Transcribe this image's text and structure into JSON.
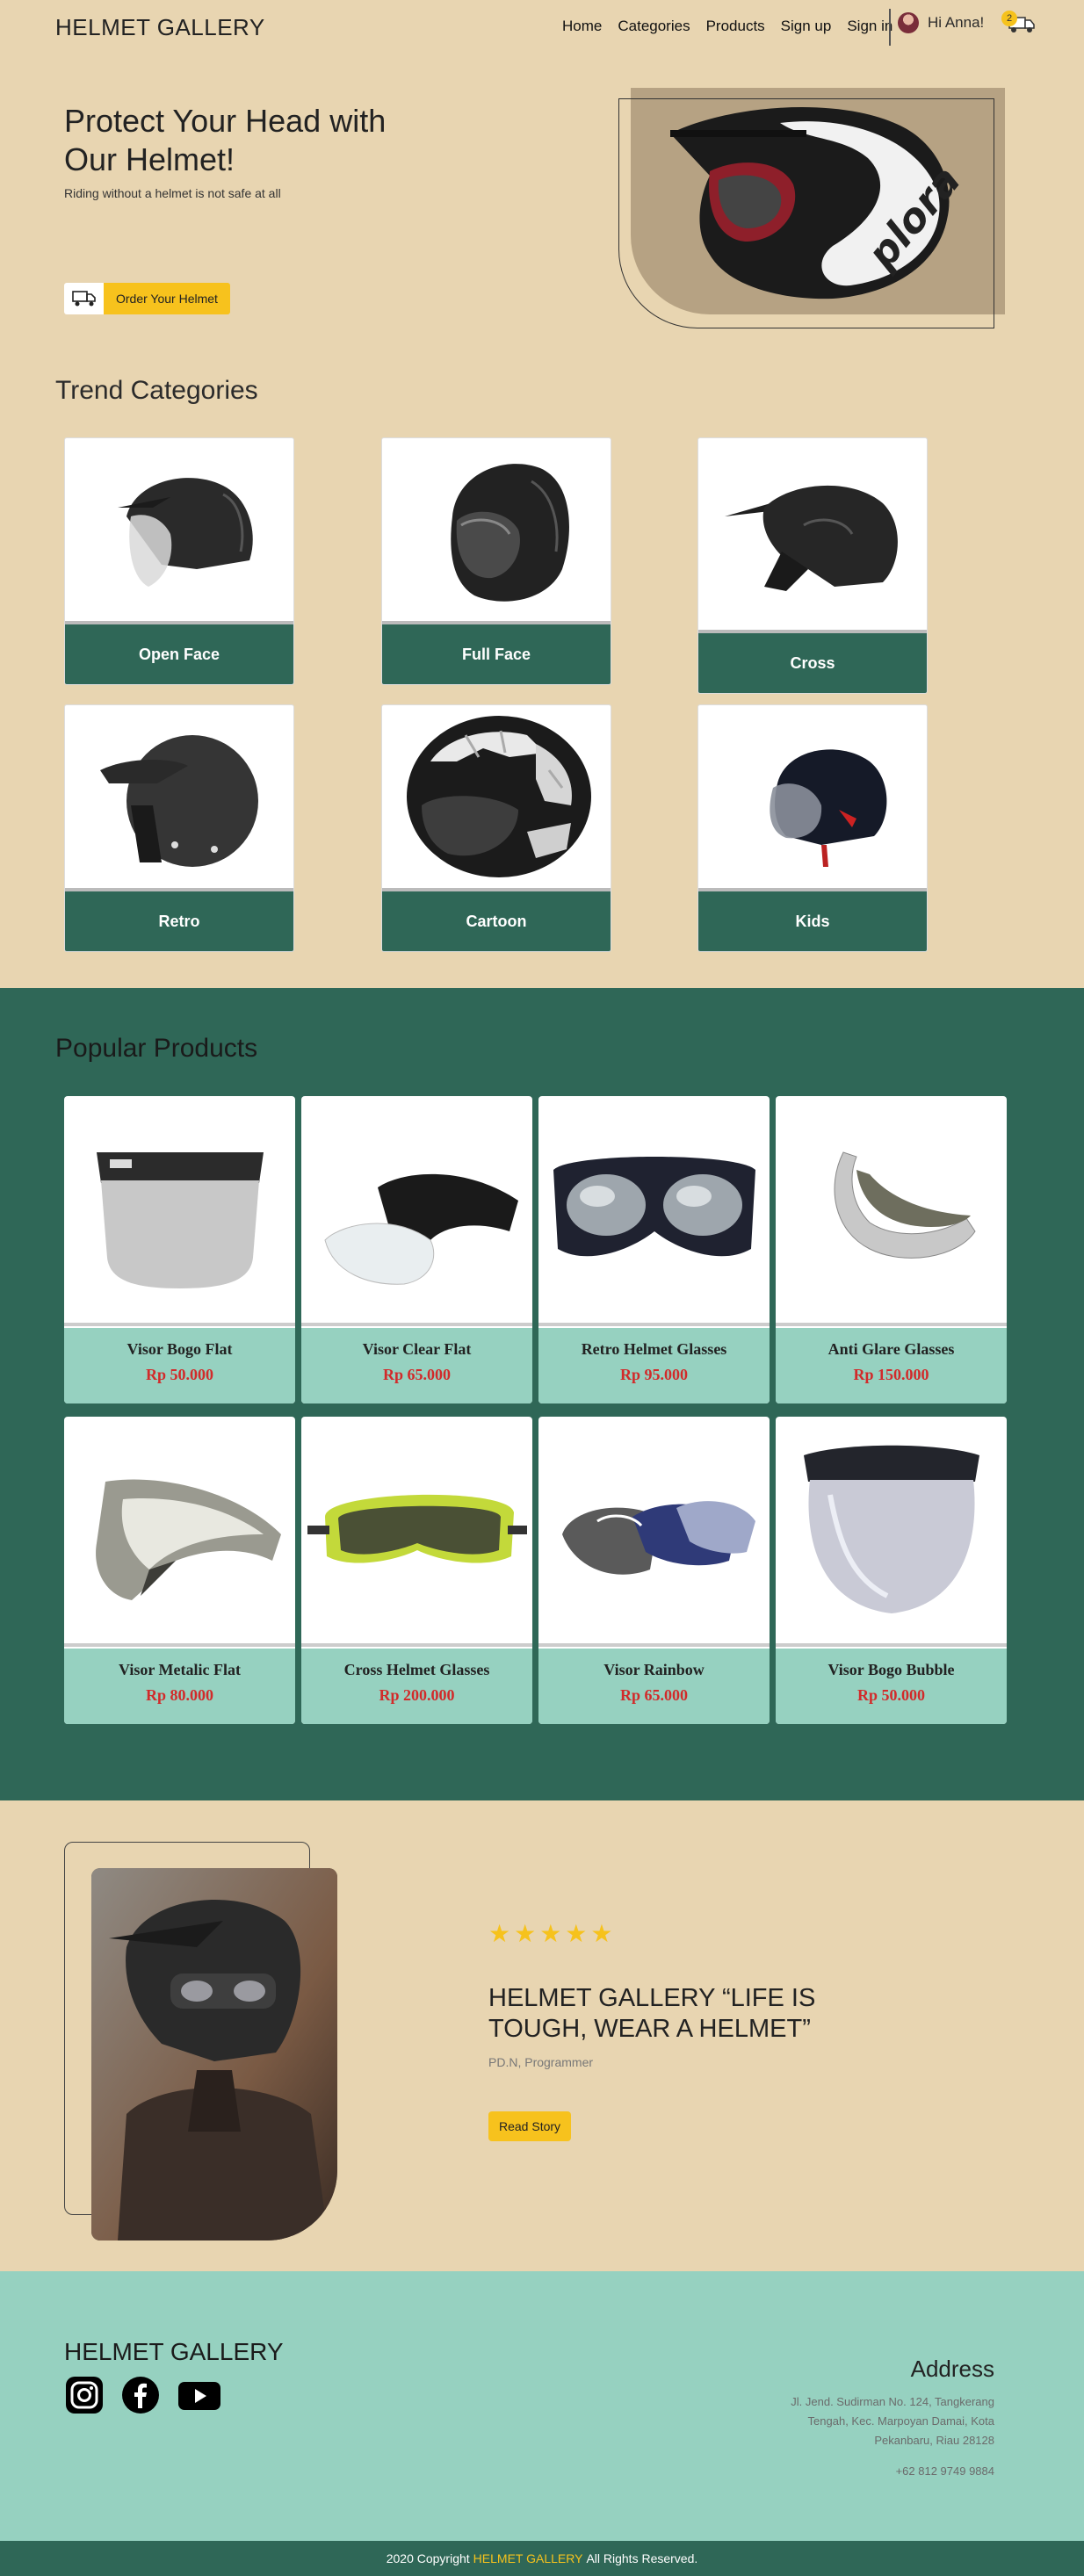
{
  "nav": {
    "brand": "HELMET GALLERY",
    "links": [
      "Home",
      "Categories",
      "Products",
      "Sign up",
      "Sign in"
    ],
    "user_greeting": "Hi Anna!",
    "cart_count": "2"
  },
  "hero": {
    "title": "Protect Your Head with Our Helmet!",
    "subtitle": "Riding without a helmet is not safe at all",
    "cta_label": "Order Your Helmet"
  },
  "categories": {
    "title": "Trend Categories",
    "items": [
      {
        "label": "Open Face"
      },
      {
        "label": "Full Face"
      },
      {
        "label": "Cross"
      },
      {
        "label": "Retro"
      },
      {
        "label": "Cartoon"
      },
      {
        "label": "Kids"
      }
    ]
  },
  "popular": {
    "title": "Popular Products",
    "items": [
      {
        "name": "Visor Bogo Flat",
        "price": "Rp 50.000"
      },
      {
        "name": "Visor Clear Flat",
        "price": "Rp 65.000"
      },
      {
        "name": "Retro Helmet Glasses",
        "price": "Rp 95.000"
      },
      {
        "name": "Anti Glare Glasses",
        "price": "Rp 150.000"
      },
      {
        "name": "Visor Metalic Flat",
        "price": "Rp 80.000"
      },
      {
        "name": "Cross Helmet Glasses",
        "price": "Rp 200.000"
      },
      {
        "name": "Visor Rainbow",
        "price": "Rp 65.000"
      },
      {
        "name": "Visor Bogo Bubble",
        "price": "Rp 50.000"
      }
    ]
  },
  "testimonial": {
    "stars": "★★★★★",
    "quote": "HELMET GALLERY “LIFE IS TOUGH, WEAR A HELMET”",
    "author": "PD.N, Programmer",
    "button_label": "Read Story"
  },
  "footer": {
    "brand": "HELMET GALLERY",
    "address_title": "Address",
    "address": "Jl. Jend. Sudirman No. 124, Tangkerang Tengah, Kec. Marpoyan Damai, Kota Pekanbaru, Riau 28128",
    "phone": "+62 812 9749 9884",
    "copy_prefix": "2020 Copyright",
    "copy_brand": "HELMET GALLERY",
    "copy_suffix": "All Rights Reserved."
  },
  "colors": {
    "background": "#e8d5b1",
    "dark_green": "#2f6757",
    "mint": "#96d1c0",
    "accent_yellow": "#f7c21d",
    "price_red": "#d22a2a"
  }
}
